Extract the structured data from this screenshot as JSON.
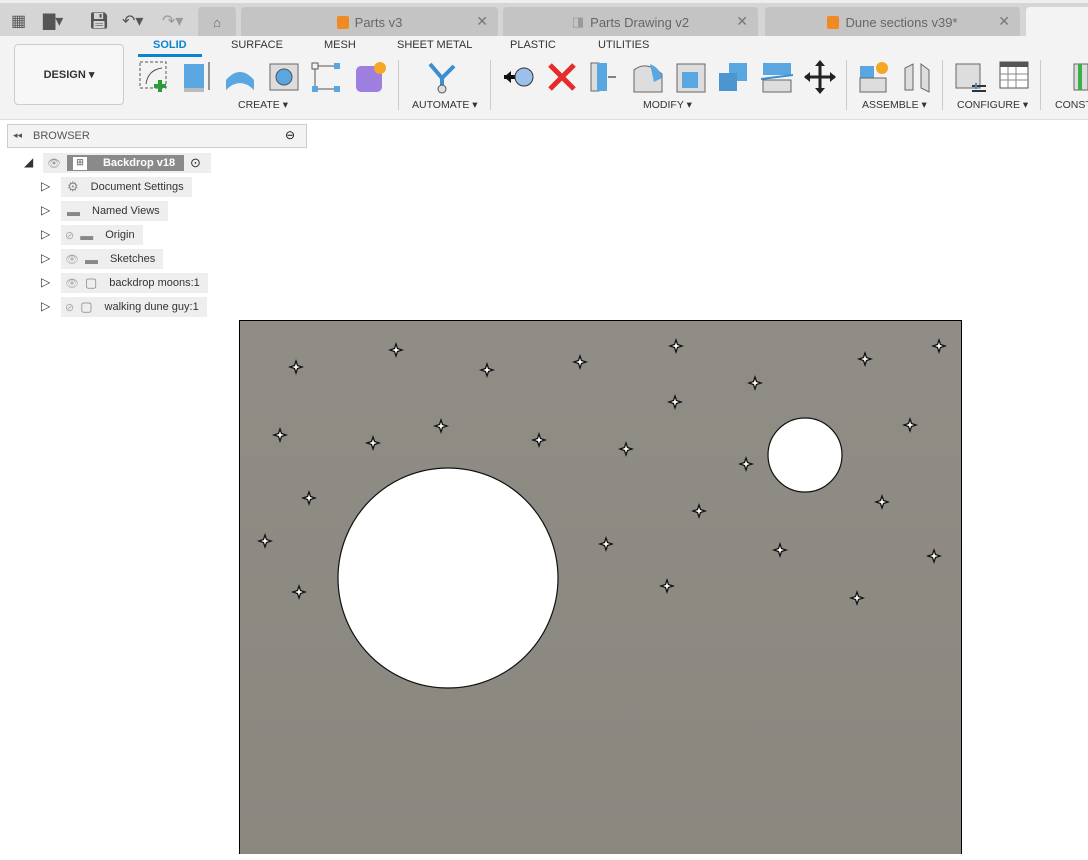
{
  "tabs": [
    {
      "label": "Parts v3",
      "icon": "part-cube-icon"
    },
    {
      "label": "Parts Drawing v2",
      "icon": "drawing-icon"
    },
    {
      "label": "Dune sections v39*",
      "icon": "part-cube-icon"
    }
  ],
  "workspace": "DESIGN",
  "ribbon_tabs": [
    "SOLID",
    "SURFACE",
    "MESH",
    "SHEET METAL",
    "PLASTIC",
    "UTILITIES"
  ],
  "active_ribbon_tab": "SOLID",
  "groups": {
    "create": "CREATE",
    "automate": "AUTOMATE",
    "modify": "MODIFY",
    "assemble": "ASSEMBLE",
    "configure": "CONFIGURE",
    "construct": "CONST"
  },
  "browser": {
    "title": "BROWSER",
    "root": "Backdrop v18",
    "items": [
      {
        "label": "Document Settings",
        "icon": "gear-icon"
      },
      {
        "label": "Named Views",
        "icon": "folder-icon"
      },
      {
        "label": "Origin",
        "icon": "folder-icon",
        "visible": false
      },
      {
        "label": "Sketches",
        "icon": "folder-icon",
        "visible": true
      },
      {
        "label": "backdrop moons:1",
        "icon": "component-icon",
        "visible": true
      },
      {
        "label": "walking dune guy:1",
        "icon": "component-icon",
        "visible": false
      }
    ]
  },
  "colors": {
    "accent": "#0a84d0",
    "canvas": "#8e8b84",
    "orange": "#f08a24"
  }
}
